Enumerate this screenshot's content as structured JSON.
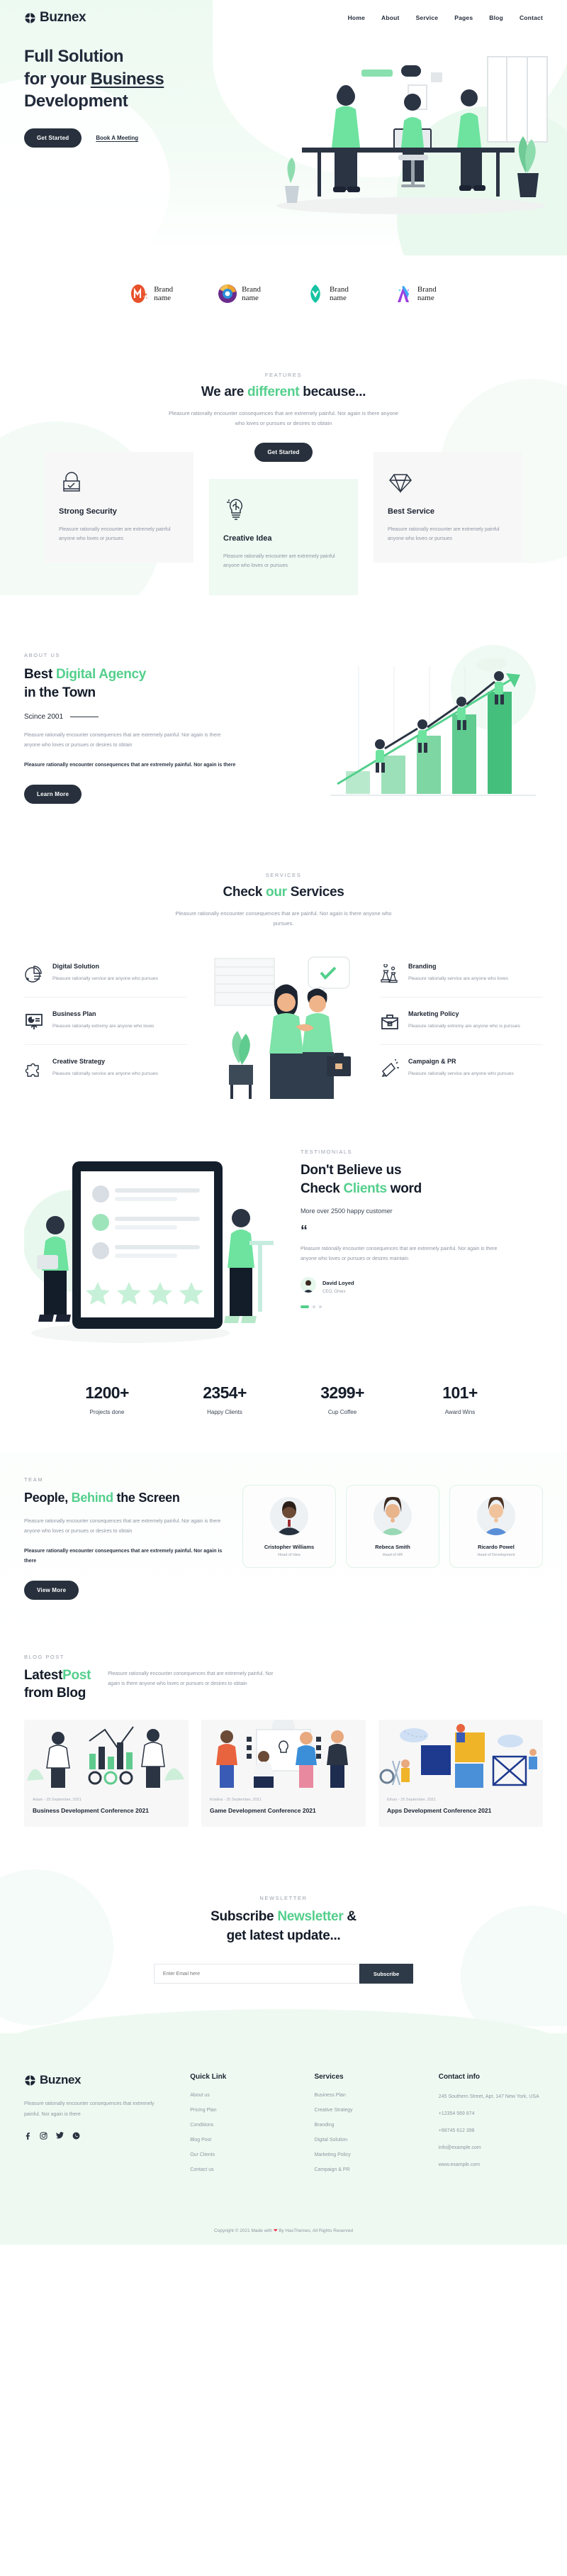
{
  "brandName": "Buznex",
  "nav": {
    "items": [
      {
        "label": "Home"
      },
      {
        "label": "About"
      },
      {
        "label": "Service"
      },
      {
        "label": "Pages"
      },
      {
        "label": "Blog"
      },
      {
        "label": "Contact"
      }
    ]
  },
  "hero": {
    "line1": "Full Solution",
    "line2_pre": "for your ",
    "line2_underline": "Business",
    "line3": "Development",
    "primary_cta": "Get Started",
    "secondary_cta": "Book A Meeting"
  },
  "brands": [
    {
      "name_line1": "Brand",
      "name_line2": "name",
      "color": "#e8502a",
      "glyph": "M"
    },
    {
      "name_line1": "Brand",
      "name_line2": "name",
      "color": "#f0a32c",
      "glyph": "C"
    },
    {
      "name_line1": "Brand",
      "name_line2": "name",
      "color": "#17c3a2",
      "glyph": "N"
    },
    {
      "name_line1": "Brand",
      "name_line2": "name",
      "color": "#9b3fe0",
      "glyph": "A"
    }
  ],
  "features": {
    "kicker": "FEATURES",
    "title_pre": "We are ",
    "title_accent": "different",
    "title_post": " because...",
    "subtitle": "Pleasure rationally encounter consequences that are extremely painful. Nor again is there anyone who loves or pursues or desires to obtain",
    "cta": "Get Started",
    "cards": [
      {
        "icon": "lock-check-icon",
        "title": "Strong Security",
        "text": "Pleasure rationally encounter are extremely painful anyone who loves or pursues"
      },
      {
        "icon": "brain-bulb-icon",
        "title": "Creative Idea",
        "text": "Pleasure rationally encounter are extremely painful anyone who loves or pursues"
      },
      {
        "icon": "diamond-icon",
        "title": "Best Service",
        "text": "Pleasure rationally encounter are extremely painful anyone who loves or pursues"
      }
    ]
  },
  "about": {
    "kicker": "ABOUT US",
    "title_pre": "Best ",
    "title_accent": "Digital Agency",
    "title_post": "in the Town",
    "since": "Scince 2001",
    "paragraph1": "Pleasure rationally encounter consequences that are extremely painful. Nor again is there anyone who loves or pursues or desires to obtain",
    "paragraph2": "Pleasure rationally encounter consequences that are extremely painful. Nor again is there",
    "cta": "Learn More"
  },
  "services": {
    "kicker": "SERVICES",
    "title_pre": "Check ",
    "title_accent": "our",
    "title_post": " Services",
    "subtitle": "Pleasure rationally encounter consequences that are painful. Nor again is there anyone who pursues.",
    "left": [
      {
        "icon": "pie-chart-icon",
        "title": "Digital Solution",
        "text": "Pleasure rationally service are anyone who pursues"
      },
      {
        "icon": "presentation-icon",
        "title": "Business Plan",
        "text": "Pleasure rationally extremy are anyone who loves"
      },
      {
        "icon": "puzzle-icon",
        "title": "Creative Strategy",
        "text": "Pleasure rationally service are anyone who pursues"
      }
    ],
    "right": [
      {
        "icon": "chess-icon",
        "title": "Branding",
        "text": "Pleasure rationally service are anyone who loves"
      },
      {
        "icon": "briefcase-icon",
        "title": "Marketing Policy",
        "text": "Pleasure rationally extremy are anyone who is pursues"
      },
      {
        "icon": "megaphone-icon",
        "title": "Campaign & PR",
        "text": "Pleasure rationally service are anyone who pursues"
      }
    ]
  },
  "testimonials": {
    "kicker": "TESTIMONIALS",
    "title_line1": "Don't Believe us",
    "title_line2_pre": "Check ",
    "title_line2_accent": "Clients",
    "title_line2_post": " word",
    "subtitle": "More over 2500 happy customer",
    "quote_mark": "“",
    "quote": "Pleasure rationally encounter consequences that are extremely painful. Nor again is there anyone who loves or pursues or desires maintain",
    "author": "David Loyed",
    "role": "CEO, Omex"
  },
  "stats": [
    {
      "value": "1200+",
      "label": "Projects done"
    },
    {
      "value": "2354+",
      "label": "Happy Clients"
    },
    {
      "value": "3299+",
      "label": "Cup Coffee"
    },
    {
      "value": "101+",
      "label": "Award Wins"
    }
  ],
  "team": {
    "kicker": "TEAM",
    "title_pre": "People, ",
    "title_accent": "Behind",
    "title_post": " the Screen",
    "paragraph1": "Pleasure rationally encounter consequences that are extremely painful. Nor again is there anyone who loves or pursues or desires to obtain",
    "paragraph2": "Pleasure rationally encounter consequences that are extremely painful. Nor again is there",
    "cta": "View More",
    "members": [
      {
        "name": "Cristopher Williams",
        "role": "Head of Idea"
      },
      {
        "name": "Rebeca Smith",
        "role": "Head of HR"
      },
      {
        "name": "Ricardo Powel",
        "role": "Head of Development"
      }
    ]
  },
  "blog": {
    "kicker": "BLOG POST",
    "title_pre": "Latest",
    "title_accent": "Post",
    "title_post": "from Blog",
    "subtitle": "Pleasure rationally encounter consequences that are extremely painful. Nor again is there anyone who loves or pursues or desires to obtain",
    "posts": [
      {
        "meta": "Adam - 25 September, 2021",
        "title": "Business Development Conference 2021"
      },
      {
        "meta": "Kristina - 25 September, 2021",
        "title": "Game Development Conference 2021"
      },
      {
        "meta": "Ethan - 25 September, 2021",
        "title": "Apps Development Conference 2021"
      }
    ]
  },
  "newsletter": {
    "kicker": "NEWSLETTER",
    "title_pre": "Subscribe ",
    "title_accent": "Newsletter",
    "title_post": " &",
    "title_line2": "get latest update...",
    "placeholder": "Enter Email here",
    "button": "Subscribe"
  },
  "footer": {
    "description": "Pleasure rationally encounter consequences that extremely painful. Nor again is there",
    "social": [
      {
        "name": "facebook-icon",
        "glyph": "f"
      },
      {
        "name": "instagram-icon",
        "glyph": "▢"
      },
      {
        "name": "twitter-icon",
        "glyph": "ᵛ"
      },
      {
        "name": "whatsapp-icon",
        "glyph": "●"
      }
    ],
    "quick_link": {
      "heading": "Quick Link",
      "items": [
        "About us",
        "Pricing Plan",
        "Conditions",
        "Blog Post",
        "Our Clients",
        "Contact us"
      ]
    },
    "services": {
      "heading": "Services",
      "items": [
        "Business Plan",
        "Creative Strategy",
        "Branding",
        "Digital Solution",
        "Marketing Policy",
        "Campaign & PR"
      ]
    },
    "contact": {
      "heading": "Contact info",
      "address": "245 Southern Street, Apt. 147 New York, USA",
      "phone1": "+12354 569 874",
      "phone2": "+98745 612 398",
      "email": "info@example.com",
      "website": "www.example.com"
    },
    "copyright_pre": "Copyright © 2021 Made with ",
    "copyright_post": " By HasThemes, All Rights Reserved"
  },
  "colors": {
    "accent": "#54cf8c",
    "dark": "#27303c",
    "mint": "#eefaf1"
  }
}
